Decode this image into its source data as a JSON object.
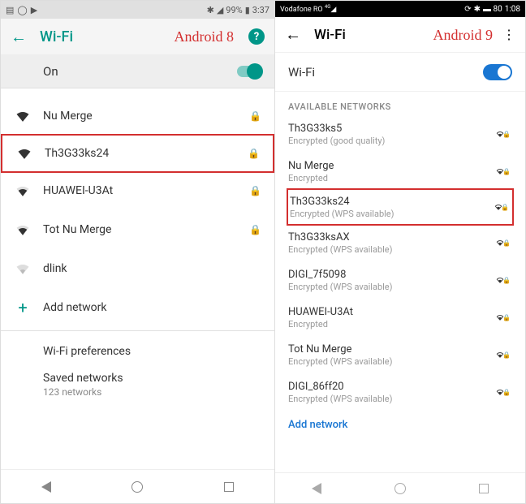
{
  "left": {
    "statusbar": {
      "battery": "99%",
      "time": "3:37"
    },
    "header": {
      "title": "Wi-Fi",
      "badge": "Android 8"
    },
    "onrow": {
      "label": "On"
    },
    "networks": [
      {
        "name": "Nu Merge",
        "strength": "full",
        "locked": true,
        "highlighted": false
      },
      {
        "name": "Th3G33ks24",
        "strength": "full",
        "locked": true,
        "highlighted": true
      },
      {
        "name": "HUAWEI-U3At",
        "strength": "medium",
        "locked": true,
        "highlighted": false
      },
      {
        "name": "Tot Nu Merge",
        "strength": "medium",
        "locked": true,
        "highlighted": false
      },
      {
        "name": "dlink",
        "strength": "low",
        "locked": false,
        "highlighted": false
      }
    ],
    "add_label": "Add network",
    "prefs_label": "Wi-Fi preferences",
    "saved": {
      "title": "Saved networks",
      "subtitle": "123 networks"
    }
  },
  "right": {
    "statusbar": {
      "carrier": "Vodafone RO",
      "time": "1:08"
    },
    "header": {
      "title": "Wi-Fi",
      "badge": "Android 9"
    },
    "wifirow": {
      "label": "Wi-Fi"
    },
    "section": "AVAILABLE NETWORKS",
    "networks": [
      {
        "name": "Th3G33ks5",
        "sub": "Encrypted (good quality)",
        "locked": true,
        "highlighted": false
      },
      {
        "name": "Nu Merge",
        "sub": "Encrypted",
        "locked": true,
        "highlighted": false
      },
      {
        "name": "Th3G33ks24",
        "sub": "Encrypted (WPS available)",
        "locked": true,
        "highlighted": true
      },
      {
        "name": "Th3G33ksAX",
        "sub": "Encrypted (WPS available)",
        "locked": true,
        "highlighted": false
      },
      {
        "name": "DIGI_7f5098",
        "sub": "Encrypted (WPS available)",
        "locked": true,
        "highlighted": false
      },
      {
        "name": "HUAWEI-U3At",
        "sub": "Encrypted",
        "locked": true,
        "highlighted": false
      },
      {
        "name": "Tot Nu Merge",
        "sub": "Encrypted (WPS available)",
        "locked": true,
        "highlighted": false
      },
      {
        "name": "DIGI_86ff20",
        "sub": "Encrypted (WPS available)",
        "locked": true,
        "highlighted": false
      }
    ],
    "add_label": "Add network"
  }
}
